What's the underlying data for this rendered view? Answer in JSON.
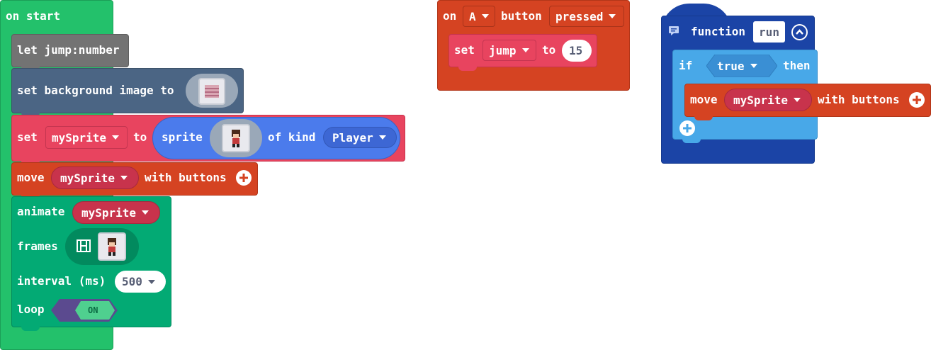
{
  "on_start": {
    "hat_label": "on start",
    "let_stmt": {
      "label": "let jump:number"
    },
    "set_background": {
      "label": "set background image to",
      "image_icon": "image-thumbnail-icon"
    },
    "set_sprite": {
      "set_label": "set",
      "var_name": "mySprite",
      "to_label": "to",
      "sprite_label": "sprite",
      "sprite_icon": "player-sprite-icon",
      "of_kind_label": "of kind",
      "kind_value": "Player"
    },
    "move_sprite": {
      "move_label": "move",
      "var_name": "mySprite",
      "with_buttons_label": "with buttons"
    },
    "animate": {
      "animate_label": "animate",
      "var_name": "mySprite",
      "frames_label": "frames",
      "frames_icon": "film-strip-icon",
      "interval_label": "interval (ms)",
      "interval_value": "500",
      "loop_label": "loop",
      "loop_value": "ON"
    }
  },
  "on_button": {
    "on_label": "on",
    "button_value": "A",
    "button_label": "button",
    "event_value": "pressed",
    "set_stmt": {
      "set_label": "set",
      "var_name": "jump",
      "to_label": "to",
      "value": "15"
    }
  },
  "function_block": {
    "function_label": "function",
    "name": "run",
    "if_label": "if",
    "condition": "true",
    "then_label": "then",
    "move_stmt": {
      "move_label": "move",
      "var_name": "mySprite",
      "with_buttons_label": "with buttons"
    }
  },
  "colors": {
    "events_green": "#23c16b",
    "variables_gray": "#737373",
    "scene_slate": "#4b6584",
    "sprites_pink": "#e8445f",
    "sprites_blue": "#4b7bec",
    "controller_orange": "#d54322",
    "animation_teal": "#03aa74",
    "functions_navy": "#1b44a6",
    "logic_blue": "#48a8e8",
    "loop_purple": "#5b4a8f"
  }
}
